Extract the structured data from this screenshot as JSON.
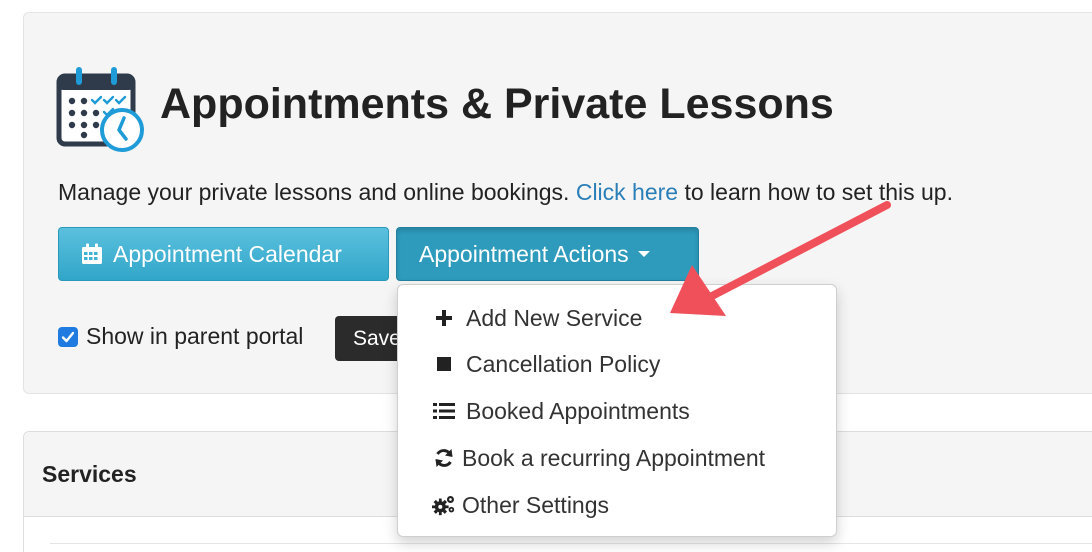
{
  "header": {
    "title": "Appointments & Private Lessons",
    "description_prefix": "Manage your private lessons and online bookings. ",
    "description_link": "Click here",
    "description_suffix": " to learn how to set this up.",
    "icon": "calendar-clock-icon"
  },
  "toolbar": {
    "calendar_button_label": "Appointment Calendar",
    "actions_button_label": "Appointment Actions"
  },
  "portal": {
    "checkbox_label": "Show in parent portal",
    "checked": true,
    "save_label": "Save"
  },
  "dropdown": {
    "items": [
      {
        "label": "Add New Service",
        "icon": "plus-icon"
      },
      {
        "label": "Cancellation Policy",
        "icon": "stop-icon"
      },
      {
        "label": "Booked Appointments",
        "icon": "list-icon"
      },
      {
        "label": "Book a recurring Appointment",
        "icon": "refresh-icon"
      },
      {
        "label": "Other Settings",
        "icon": "gears-icon"
      }
    ]
  },
  "services": {
    "heading": "Services"
  },
  "colors": {
    "link": "#2a7fb8",
    "info_button": "#5bc0de",
    "annotation_arrow": "#f0505a",
    "icon_blue": "#1f9bd7",
    "icon_dark": "#2f3a4a"
  }
}
